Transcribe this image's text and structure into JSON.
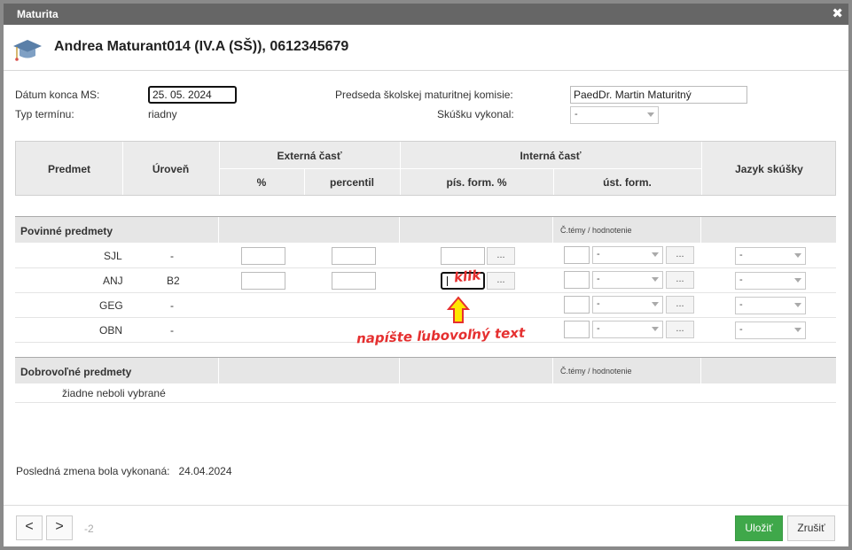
{
  "window": {
    "title": "Maturita",
    "close_glyph": "✖"
  },
  "student": {
    "name": "Andrea Maturant014 (IV.A (SŠ)), 0612345679",
    "icon": "graduation-cap-icon"
  },
  "form": {
    "end_date_label": "Dátum konca MS:",
    "end_date_value": "25. 05. 2024",
    "term_type_label": "Typ termínu:",
    "term_type_value": "riadny",
    "chair_label": "Predseda školskej maturitnej komisie:",
    "chair_value": "PaedDr. Martin Maturitný",
    "performed_label": "Skúšku vykonal:",
    "performed_value": "-"
  },
  "table": {
    "col_subject": "Predmet",
    "col_level": "Úroveň",
    "external": "Externá časť",
    "ext_pct": "%",
    "ext_percentile": "percentil",
    "internal": "Interná časť",
    "int_written": "pís. form. %",
    "int_oral": "úst. form.",
    "col_language": "Jazyk skúšky"
  },
  "sections": {
    "mandatory": "Povinné predmety",
    "optional": "Dobrovoľné predmety",
    "topics_label": "Č.témy / hodnotenie",
    "none_text": "žiadne neboli vybrané"
  },
  "subjects": [
    {
      "name": "SJL",
      "level": "-",
      "oral": "-",
      "language": "-",
      "dots": "..."
    },
    {
      "name": "ANJ",
      "level": "B2",
      "oral": "-",
      "language": "-",
      "dots": "..."
    },
    {
      "name": "GEG",
      "level": "-",
      "oral": "-",
      "language": "-",
      "dots": "..."
    },
    {
      "name": "OBN",
      "level": "-",
      "oral": "-",
      "language": "-",
      "dots": "..."
    }
  ],
  "annotations": {
    "click": "klik",
    "hint": "napíšte ľubovoľný text",
    "color": "#e53030"
  },
  "footer": {
    "last_change_label": "Posledná zmena bola vykonaná:",
    "last_change_date": "24.04.2024",
    "prev": "<",
    "next": ">",
    "page": "-2",
    "save": "Uložiť",
    "cancel": "Zrušiť"
  },
  "colors": {
    "titlebar": "#666666",
    "save": "#3fa84a",
    "header_bg": "#ebebeb"
  }
}
